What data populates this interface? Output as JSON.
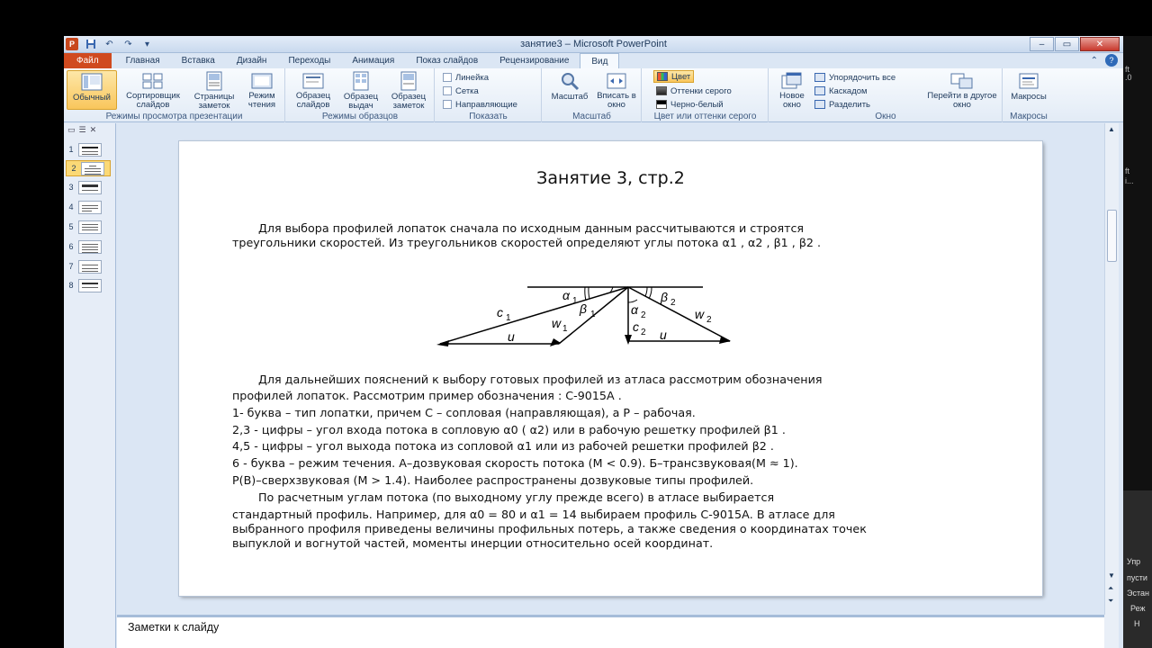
{
  "window": {
    "title": "занятие3 – Microsoft PowerPoint",
    "qat_icons": [
      "powerpoint-logo",
      "save-icon",
      "undo-icon",
      "redo-icon",
      "customize-icon"
    ],
    "controls": {
      "minimize": "–",
      "maximize": "▭",
      "close": "✕"
    }
  },
  "tabs": [
    "Файл",
    "Главная",
    "Вставка",
    "Дизайн",
    "Переходы",
    "Анимация",
    "Показ слайдов",
    "Рецензирование",
    "Вид"
  ],
  "active_tab": "Вид",
  "ribbon": {
    "presentation_views": {
      "label": "Режимы просмотра презентации",
      "buttons": [
        "Обычный",
        "Сортировщик слайдов",
        "Страницы заметок",
        "Режим чтения"
      ]
    },
    "master_views": {
      "label": "Режимы образцов",
      "buttons": [
        "Образец слайдов",
        "Образец выдач",
        "Образец заметок"
      ]
    },
    "show": {
      "label": "Показать",
      "items": [
        "Линейка",
        "Сетка",
        "Направляющие"
      ]
    },
    "zoom": {
      "label": "Масштаб",
      "buttons": [
        "Масштаб",
        "Вписать в окно"
      ]
    },
    "color": {
      "label": "Цвет или оттенки серого",
      "items": [
        "Цвет",
        "Оттенки серого",
        "Черно-белый"
      ]
    },
    "window": {
      "label": "Окно",
      "new_window": "Новое окно",
      "items": [
        "Упорядочить все",
        "Каскадом",
        "Разделить"
      ],
      "switch": "Перейти в другое окно"
    },
    "macros": {
      "label": "Макросы",
      "button": "Макросы"
    }
  },
  "thumbnails": [
    "1",
    "2",
    "3",
    "4",
    "5",
    "6",
    "7",
    "8"
  ],
  "selected_slide": "2",
  "slide": {
    "title": "Занятие 3, стр.2",
    "p1": [
      "Для выбора профилей лопаток сначала по исходным данным рассчитываются и строятся",
      "треугольники скоростей. Из треугольников скоростей определяют углы потока  α1 , α2 , β1 , β2 ."
    ],
    "diagram": {
      "c1": "c",
      "c1s": "1",
      "w1": "w",
      "w1s": "1",
      "u_left": "u",
      "a1": "α",
      "a1s": "1",
      "b1": "β",
      "b1s": "1",
      "a2": "α",
      "a2s": "2",
      "b2": "β",
      "b2s": "2",
      "c2": "c",
      "c2s": "2",
      "w2": "w",
      "w2s": "2",
      "u_right": "u"
    },
    "p2": [
      "Для дальнейших пояснений к выбору готовых профилей из атласа рассмотрим обозначения",
      "профилей лопаток. Рассмотрим пример обозначения : С-9015А .",
      "1- буква – тип лопатки, причем С – сопловая (направляющая), а Р – рабочая.",
      "2,3 - цифры – угол входа потока в сопловую α0 ( α2) или в рабочую решетку профилей β1 .",
      "4,5 - цифры – угол выхода потока из сопловой α1 или из рабочей решетки  профилей β2 .",
      "6 - буква – режим течения. А–дозвуковая скорость потока (M < 0.9). Б–трансзвуковая(M ≈ 1).",
      "Р(В)–сверхзвуковая (M > 1.4). Наиболее распространены дозвуковые типы профилей.",
      "По расчетным углам потока (по выходному углу прежде всего) в атласе выбирается",
      "стандартный профиль. Например, для α0 = 80 и α1 = 14 выбираем профиль С-9015А. В атласе для",
      "выбранного профиля приведены величины профильных потерь, а также сведения о  координатах точек",
      "выпуклой и вогнутой частей, моменты инерции относительно осей координат."
    ]
  },
  "notes_placeholder": "Заметки к слайду",
  "desktop_right": [
    "ft",
    ".0",
    "ft",
    "i...",
    "Упр",
    "пусти",
    "Эстан",
    "Реж",
    "Н"
  ]
}
